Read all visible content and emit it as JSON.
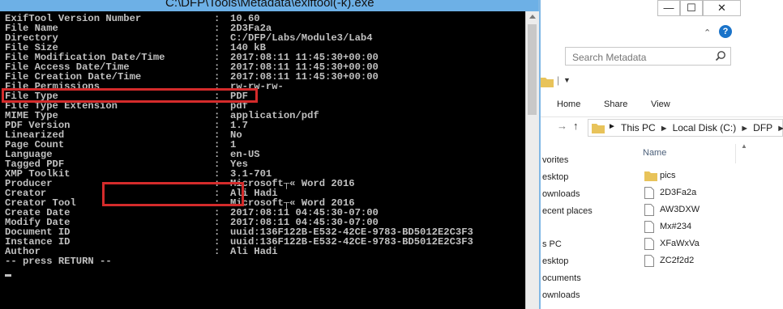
{
  "console": {
    "title": "C:\\DFP\\Tools\\Metadata\\exiftool(-k).exe",
    "lines": [
      {
        "label": "ExifTool Version Number",
        "value": "10.60"
      },
      {
        "label": "File Name",
        "value": "2D3Fa2a"
      },
      {
        "label": "Directory",
        "value": "C:/DFP/Labs/Module3/Lab4"
      },
      {
        "label": "File Size",
        "value": "140 kB"
      },
      {
        "label": "File Modification Date/Time",
        "value": "2017:08:11 11:45:30+00:00"
      },
      {
        "label": "File Access Date/Time",
        "value": "2017:08:11 11:45:30+00:00"
      },
      {
        "label": "File Creation Date/Time",
        "value": "2017:08:11 11:45:30+00:00"
      },
      {
        "label": "File Permissions",
        "value": "rw-rw-rw-"
      },
      {
        "label": "File Type",
        "value": "PDF"
      },
      {
        "label": "File Type Extension",
        "value": "pdf"
      },
      {
        "label": "MIME Type",
        "value": "application/pdf"
      },
      {
        "label": "PDF Version",
        "value": "1.7"
      },
      {
        "label": "Linearized",
        "value": "No"
      },
      {
        "label": "Page Count",
        "value": "1"
      },
      {
        "label": "Language",
        "value": "en-US"
      },
      {
        "label": "Tagged PDF",
        "value": "Yes"
      },
      {
        "label": "XMP Toolkit",
        "value": "3.1-701"
      },
      {
        "label": "Producer",
        "value": "Microsoft┬« Word 2016"
      },
      {
        "label": "Creator",
        "value": "Ali Hadi"
      },
      {
        "label": "Creator Tool",
        "value": "Microsoft┬« Word 2016"
      },
      {
        "label": "Create Date",
        "value": "2017:08:11 04:45:30-07:00"
      },
      {
        "label": "Modify Date",
        "value": "2017:08:11 04:45:30-07:00"
      },
      {
        "label": "Document ID",
        "value": "uuid:136F122B-E532-42CE-9783-BD5012E2C3F3"
      },
      {
        "label": "Instance ID",
        "value": "uuid:136F122B-E532-42CE-9783-BD5012E2C3F3"
      },
      {
        "label": "Author",
        "value": "Ali Hadi"
      }
    ],
    "separator": ":",
    "prompt": "-- press RETURN --",
    "highlighted_label": "File Type"
  },
  "explorer": {
    "window_buttons": {
      "minimize": "—",
      "maximize": "☐",
      "close": "✕"
    },
    "search_placeholder": "Search Metadata",
    "ribbon_tabs": [
      "Home",
      "Share",
      "View"
    ],
    "breadcrumbs": [
      "This PC",
      "Local Disk (C:)",
      "DFP"
    ],
    "nav_items": [
      "vorites",
      "esktop",
      "ownloads",
      "ecent places",
      "s PC",
      "esktop",
      "ocuments",
      "ownloads"
    ],
    "column_header": "Name",
    "files": [
      {
        "name": "pics",
        "type": "folder"
      },
      {
        "name": "2D3Fa2a",
        "type": "file"
      },
      {
        "name": "AW3DXW",
        "type": "file"
      },
      {
        "name": "Mx#234",
        "type": "file"
      },
      {
        "name": "XFaWxVa",
        "type": "file"
      },
      {
        "name": "ZC2f2d2",
        "type": "file"
      }
    ],
    "highlighted_file": "2D3Fa2a"
  },
  "colors": {
    "console_bg": "#000000",
    "console_text": "#c0c0c0",
    "titlebar": "#6db0e6",
    "highlight_box": "#d42b2b",
    "folder": "#e8c35a"
  }
}
